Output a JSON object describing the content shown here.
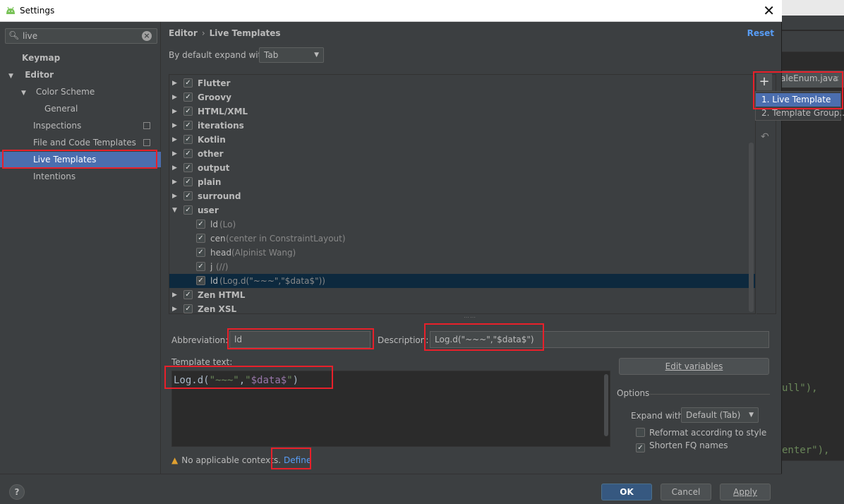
{
  "window": {
    "title": "Settings",
    "close_glyph": "✕"
  },
  "search": {
    "value": "live",
    "placeholder": ""
  },
  "sidebar": {
    "items": [
      {
        "label": "Keymap"
      },
      {
        "label": "Editor"
      },
      {
        "label": "Color Scheme"
      },
      {
        "label": "General"
      },
      {
        "label": "Inspections"
      },
      {
        "label": "File and Code Templates"
      },
      {
        "label": "Live Templates"
      },
      {
        "label": "Intentions"
      }
    ]
  },
  "header": {
    "breadcrumb": [
      "Editor",
      "Live Templates"
    ],
    "separator": "›",
    "reset_label": "Reset"
  },
  "expand": {
    "label": "By default expand with",
    "value": "Tab"
  },
  "templates": {
    "groups": [
      {
        "name": "Flutter",
        "checked": true
      },
      {
        "name": "Groovy",
        "checked": true
      },
      {
        "name": "HTML/XML",
        "checked": true
      },
      {
        "name": "iterations",
        "checked": true
      },
      {
        "name": "Kotlin",
        "checked": true
      },
      {
        "name": "other",
        "checked": true
      },
      {
        "name": "output",
        "checked": true
      },
      {
        "name": "plain",
        "checked": true
      },
      {
        "name": "surround",
        "checked": true
      },
      {
        "name": "user",
        "checked": true
      }
    ],
    "user_items": [
      {
        "abbr": "ld",
        "desc": "(Lo)"
      },
      {
        "abbr": "cen",
        "desc": "(center in ConstraintLayout)"
      },
      {
        "abbr": "head",
        "desc": "(Alpinist Wang)"
      },
      {
        "abbr": "j",
        "desc": "(//)"
      },
      {
        "abbr": "ld",
        "desc": "(Log.d(\"~~~\",\"$data$\"))"
      }
    ],
    "trailing_groups": [
      {
        "name": "Zen HTML",
        "checked": true
      },
      {
        "name": "Zen XSL",
        "checked": true
      }
    ]
  },
  "add_popup": {
    "plus": "+",
    "items": [
      "1. Live Template",
      "2. Template Group..."
    ]
  },
  "form": {
    "abbreviation_label": "Abbreviation:",
    "abbreviation_value": "ld",
    "description_label": "Description:",
    "description_value": "Log.d(\"~~~\",\"$data$\")",
    "template_text_label": "Template text:",
    "code_prefix": "Log.d(",
    "code_str1": "\"~~~\"",
    "code_comma": ",",
    "code_str2_open": "\"",
    "code_var": "$data$",
    "code_str2_close": "\"",
    "code_suffix": ")",
    "edit_variables": "Edit variables",
    "options_label": "Options",
    "expand_with_label": "Expand with",
    "expand_with_value": "Default (Tab)",
    "reformat_label": "Reformat according to style",
    "shorten_label": "Shorten FQ names",
    "warning_text": "No applicable contexts.",
    "define_link": "Define"
  },
  "footer": {
    "help": "?",
    "ok": "OK",
    "cancel": "Cancel",
    "apply": "Apply"
  },
  "background": {
    "file_tab": "aleEnum.java",
    "code_line1": "ull\"),",
    "code_line2": "enter\"),"
  }
}
